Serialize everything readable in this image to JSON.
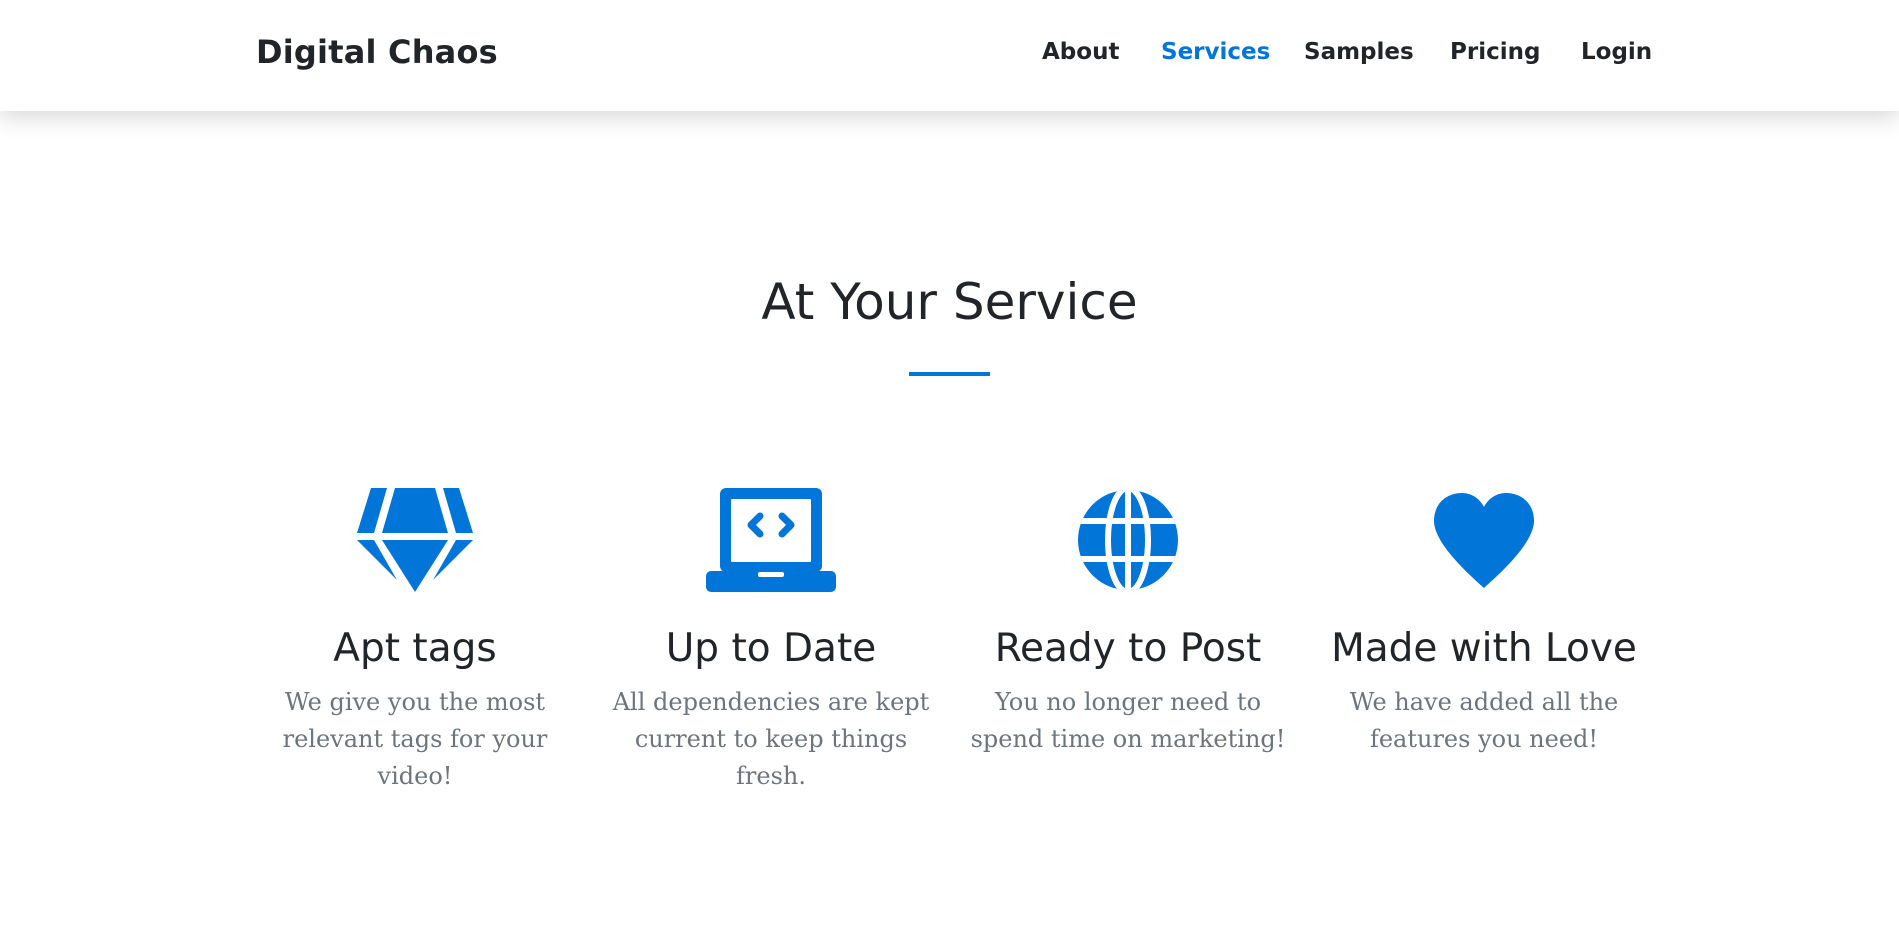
{
  "navbar": {
    "brand": "Digital Chaos",
    "links": [
      "About",
      "Services",
      "Samples",
      "Pricing",
      "Login"
    ],
    "active": "Services"
  },
  "section": {
    "title": "At Your Service"
  },
  "features": [
    {
      "icon": "gem-icon",
      "title": "Apt tags",
      "text": "We give you the most relevant tags for your video!"
    },
    {
      "icon": "laptop-code-icon",
      "title": "Up to Date",
      "text": "All dependencies are kept current to keep things fresh."
    },
    {
      "icon": "globe-icon",
      "title": "Ready to Post",
      "text": "You no longer need to spend time on marketing!"
    },
    {
      "icon": "heart-icon",
      "title": "Made with Love",
      "text": "We have added all the features you need!"
    }
  ],
  "colors": {
    "accent": "#0275d8",
    "heading": "#212529",
    "muted": "#6c757d",
    "background": "#ffffff"
  }
}
